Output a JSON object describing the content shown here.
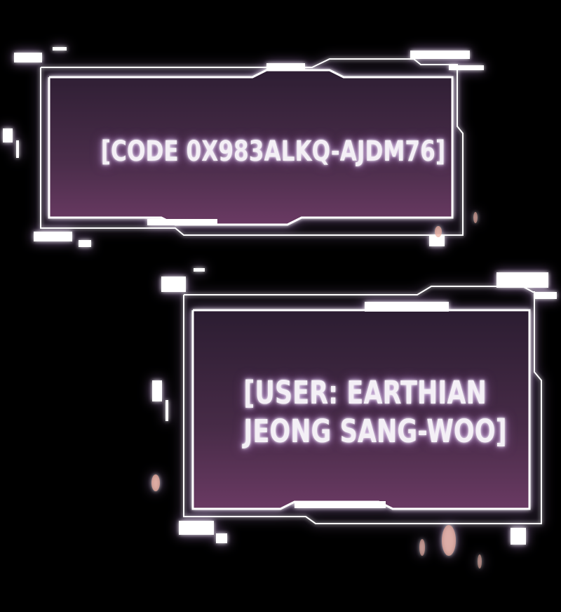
{
  "panels": [
    {
      "lines": [
        "[CODE 0X983ALKQ-AJDM76]"
      ]
    },
    {
      "lines": [
        "[USER: EARTHIAN",
        "JEONG SANG-WOO]"
      ]
    }
  ],
  "colors": {
    "background": "#000000",
    "frame": "#ffffff",
    "panel_fill_top": "#2e1e33",
    "panel_fill_bottom": "#6a3a63",
    "text": "#f4f0f6",
    "glow": "#d8a8ff"
  }
}
